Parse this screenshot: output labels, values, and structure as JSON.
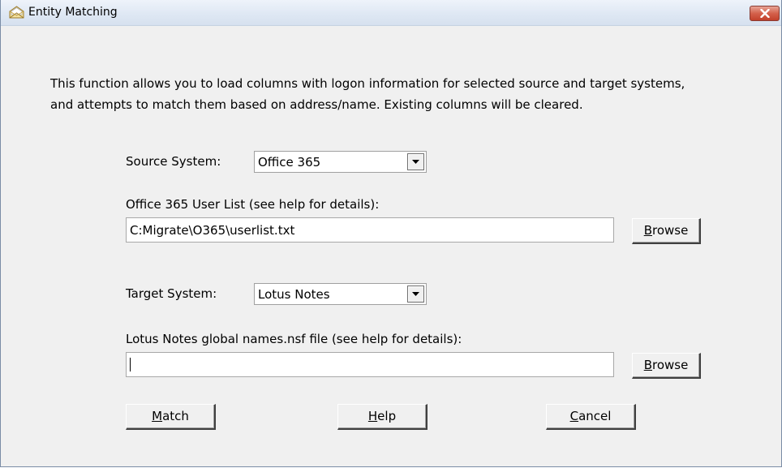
{
  "window": {
    "title": "Entity Matching"
  },
  "description": {
    "line1": "This function allows you to load columns with logon information for selected source and target systems,",
    "line2": "and attempts to match them based on address/name.  Existing columns will be cleared."
  },
  "source": {
    "label": "Source System:",
    "selected": "Office 365",
    "file_label": "Office 365 User List (see help for details):",
    "file_value": "C:Migrate\\O365\\userlist.txt",
    "browse_accel": "B",
    "browse_rest": "rowse"
  },
  "target": {
    "label": "Target System:",
    "selected": "Lotus Notes",
    "file_label": "Lotus Notes global names.nsf file (see help for details):",
    "file_value": "",
    "browse_accel": "B",
    "browse_rest": "rowse"
  },
  "actions": {
    "match_accel": "M",
    "match_rest": "atch",
    "help_accel": "H",
    "help_rest": "elp",
    "cancel_accel": "C",
    "cancel_rest": "ancel"
  },
  "icons": {
    "app": "envelope-open-icon",
    "close": "close-icon",
    "dropdown": "chevron-down-icon"
  },
  "colors": {
    "dialog_bg": "#f0f0f0",
    "close_button": "#c7432e",
    "titlebar": "#dfe8f4"
  }
}
